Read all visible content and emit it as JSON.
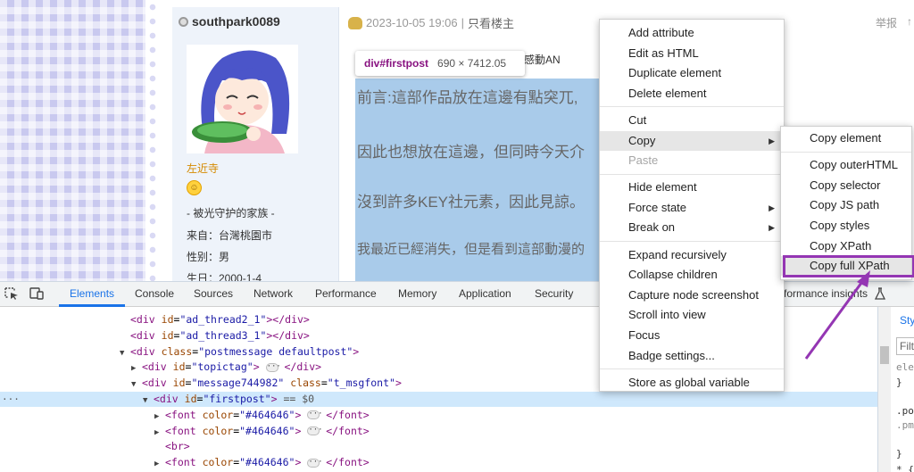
{
  "author": {
    "name": "southpark0089",
    "link_name": "左近寺",
    "lines": [
      "- 被光守护的家族 -",
      "来自：台灣桃園市",
      "性别：男",
      "生日：2000-1-4"
    ]
  },
  "post": {
    "date": "2023-10-05 19:06",
    "separator": "|",
    "only_author": "只看楼主",
    "report": "举报",
    "report_extra": "↑",
    "behind_tooltip_text": "感動AN",
    "paragraphs": [
      "前言:這部作品放在這邊有點突兀,",
      "因此也想放在這邊，但同時今天介",
      "沒到許多KEY社元素，因此見諒。",
      "我最近已經消失，但是看到這部動漫的"
    ],
    "tooltip": {
      "selector": "div#firstpost",
      "size": "690 × 7412.05"
    }
  },
  "devtools": {
    "tabs": [
      "Elements",
      "Console",
      "Sources",
      "Network",
      "Performance",
      "Memory",
      "Application",
      "Security",
      "formance insights"
    ],
    "lines": [
      {
        "indent": 146,
        "html": "<span class=\"tag\">&lt;div</span> <span class=\"attr\">id</span>=<span class=\"val\">\"ad_thread2_1\"</span><span class=\"tag\">&gt;&lt;/div&gt;</span>"
      },
      {
        "indent": 146,
        "html": "<span class=\"tag\">&lt;div</span> <span class=\"attr\">id</span>=<span class=\"val\">\"ad_thread3_1\"</span><span class=\"tag\">&gt;&lt;/div&gt;</span>"
      },
      {
        "indent": 134,
        "html": "<span class=\"tri\">▼</span><span class=\"tag\">&lt;div</span> <span class=\"attr\">class</span>=<span class=\"val\">\"postmessage defaultpost\"</span><span class=\"tag\">&gt;</span>"
      },
      {
        "indent": 147,
        "html": "<span class=\"tri\">▶</span><span class=\"tag\">&lt;div</span> <span class=\"attr\">id</span>=<span class=\"val\">\"topictag\"</span><span class=\"tag\">&gt;</span> <span class=\"ell\">···</span> <span class=\"tag\">&lt;/div&gt;</span>"
      },
      {
        "indent": 147,
        "html": "<span class=\"tri\">▼</span><span class=\"tag\">&lt;div</span> <span class=\"attr\">id</span>=<span class=\"val\">\"message744982\"</span> <span class=\"attr\">class</span>=<span class=\"val\">\"t_msgfont\"</span><span class=\"tag\">&gt;</span>"
      },
      {
        "indent": 160,
        "html": "<span class=\"tri\">▼</span><span class=\"tag\">&lt;div</span> <span class=\"attr\">id</span>=<span class=\"val\">\"firstpost\"</span><span class=\"tag\">&gt;</span> <span class=\"dim\">== $0</span>"
      },
      {
        "indent": 173,
        "html": "<span class=\"tri\">▶</span><span class=\"tag\">&lt;font</span> <span class=\"attr\">color</span>=<span class=\"val\">\"#464646\"</span><span class=\"tag\">&gt;</span> <span class=\"ell\">···</span> <span class=\"tag\">&lt;/font&gt;</span>"
      },
      {
        "indent": 173,
        "html": "<span class=\"tri\">▶</span><span class=\"tag\">&lt;font</span> <span class=\"attr\">color</span>=<span class=\"val\">\"#464646\"</span><span class=\"tag\">&gt;</span> <span class=\"ell\">···</span> <span class=\"tag\">&lt;/font&gt;</span>"
      },
      {
        "indent": 185,
        "html": "<span class=\"tag\">&lt;br&gt;</span>"
      },
      {
        "indent": 173,
        "html": "<span class=\"tri\">▶</span><span class=\"tag\">&lt;font</span> <span class=\"attr\">color</span>=<span class=\"val\">\"#464646\"</span><span class=\"tag\">&gt;</span> <span class=\"ell\">···</span> <span class=\"tag\">&lt;/font&gt;</span>"
      }
    ],
    "selected_line": 5,
    "styles_snippets": [
      "Sty",
      "Filt",
      "ele",
      "}",
      ".po",
      ".pm",
      "}",
      "* {"
    ]
  },
  "context_menu": {
    "groups": [
      [
        "Add attribute",
        "Edit as HTML",
        "Duplicate element",
        "Delete element"
      ],
      [
        "Cut",
        "Copy",
        "Paste"
      ],
      [
        "Hide element",
        "Force state",
        "Break on"
      ],
      [
        "Expand recursively",
        "Collapse children",
        "Capture node screenshot",
        "Scroll into view",
        "Focus",
        "Badge settings..."
      ],
      [
        "Store as global variable"
      ]
    ],
    "submenu_items": [
      "Force state",
      "Break on",
      "Copy"
    ],
    "disabled_items": [
      "Paste"
    ],
    "hovered_item": "Copy"
  },
  "copy_submenu": {
    "groups": [
      [
        "Copy element"
      ],
      [
        "Copy outerHTML",
        "Copy selector",
        "Copy JS path",
        "Copy styles",
        "Copy XPath",
        "Copy full XPath"
      ]
    ],
    "highlighted_item": "Copy full XPath"
  },
  "colors": {
    "highlight": "#9436b3",
    "accent": "#1a73e8",
    "selection_bg": "#cfe8fc"
  }
}
